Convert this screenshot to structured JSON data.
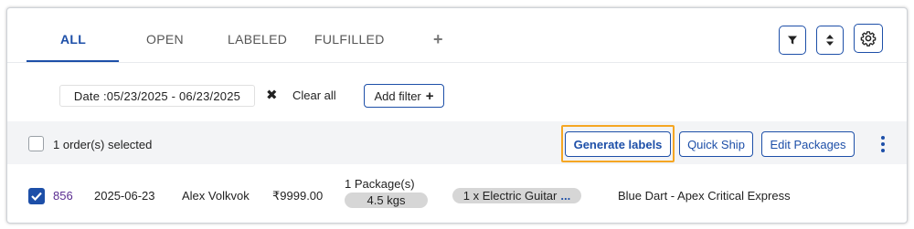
{
  "tabs": [
    {
      "label": "ALL",
      "active": true
    },
    {
      "label": "OPEN",
      "active": false
    },
    {
      "label": "LABELED",
      "active": false
    },
    {
      "label": "FULFILLED",
      "active": false
    }
  ],
  "toolbar_icons": [
    "filter-icon",
    "sort-icon",
    "settings-gear-icon"
  ],
  "filters": {
    "date_chip": "Date :05/23/2025 - 06/23/2025",
    "clear_all": "Clear all",
    "add_filter": "Add filter"
  },
  "selection": {
    "text": "1 order(s) selected",
    "generate_labels": "Generate labels",
    "quick_ship": "Quick Ship",
    "edit_packages": "Edit Packages"
  },
  "order": {
    "id": "856",
    "date": "2025-06-23",
    "customer": "Alex Volkvok",
    "amount": "₹9999.00",
    "packages": "1 Package(s)",
    "weight": "4.5 kgs",
    "items": "1 x Electric Guitar",
    "items_more": "...",
    "carrier": "Blue Dart - Apex Critical Express",
    "selected": true
  },
  "colors": {
    "accent": "#1d4fa8",
    "highlight": "#f5a623",
    "order_link": "#5a2d91"
  }
}
